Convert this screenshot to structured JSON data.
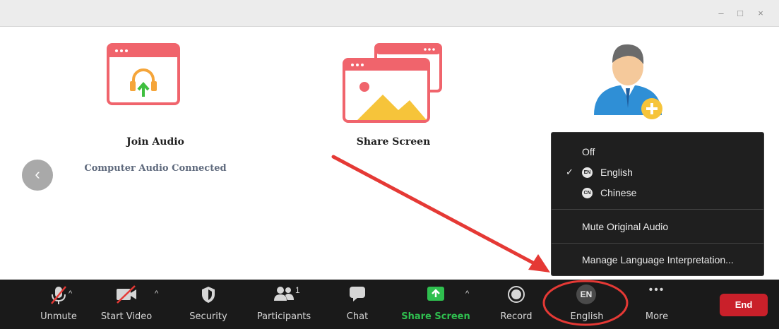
{
  "window": {
    "controls": {
      "minimize": "–",
      "maximize": "□",
      "close": "×"
    }
  },
  "main": {
    "join_audio": {
      "label": "Join Audio",
      "status": "Computer Audio Connected"
    },
    "share_screen": {
      "label": "Share Screen"
    },
    "back_button": "‹"
  },
  "interpretation_menu": {
    "off_label": "Off",
    "languages": [
      {
        "label": "English",
        "badge": "EN",
        "checked": true
      },
      {
        "label": "Chinese",
        "badge": "CN",
        "checked": false
      }
    ],
    "check_mark": "✓",
    "mute_original_audio": "Mute Original Audio",
    "manage_interpretation": "Manage Language Interpretation..."
  },
  "toolbar": {
    "unmute": "Unmute",
    "start_video": "Start Video",
    "security": "Security",
    "participants": "Participants",
    "participants_count": "1",
    "chat": "Chat",
    "share_screen": "Share Screen",
    "record": "Record",
    "interpretation": "English",
    "interpretation_badge": "EN",
    "more": "More",
    "more_icon": "•••",
    "end": "End",
    "caret": "^"
  },
  "colors": {
    "toolbar_bg": "#1a1a1a",
    "share_green": "#2fbf4f",
    "end_red": "#c9202a",
    "annotation_red": "#e53935",
    "menu_bg": "#1f1f1f"
  }
}
